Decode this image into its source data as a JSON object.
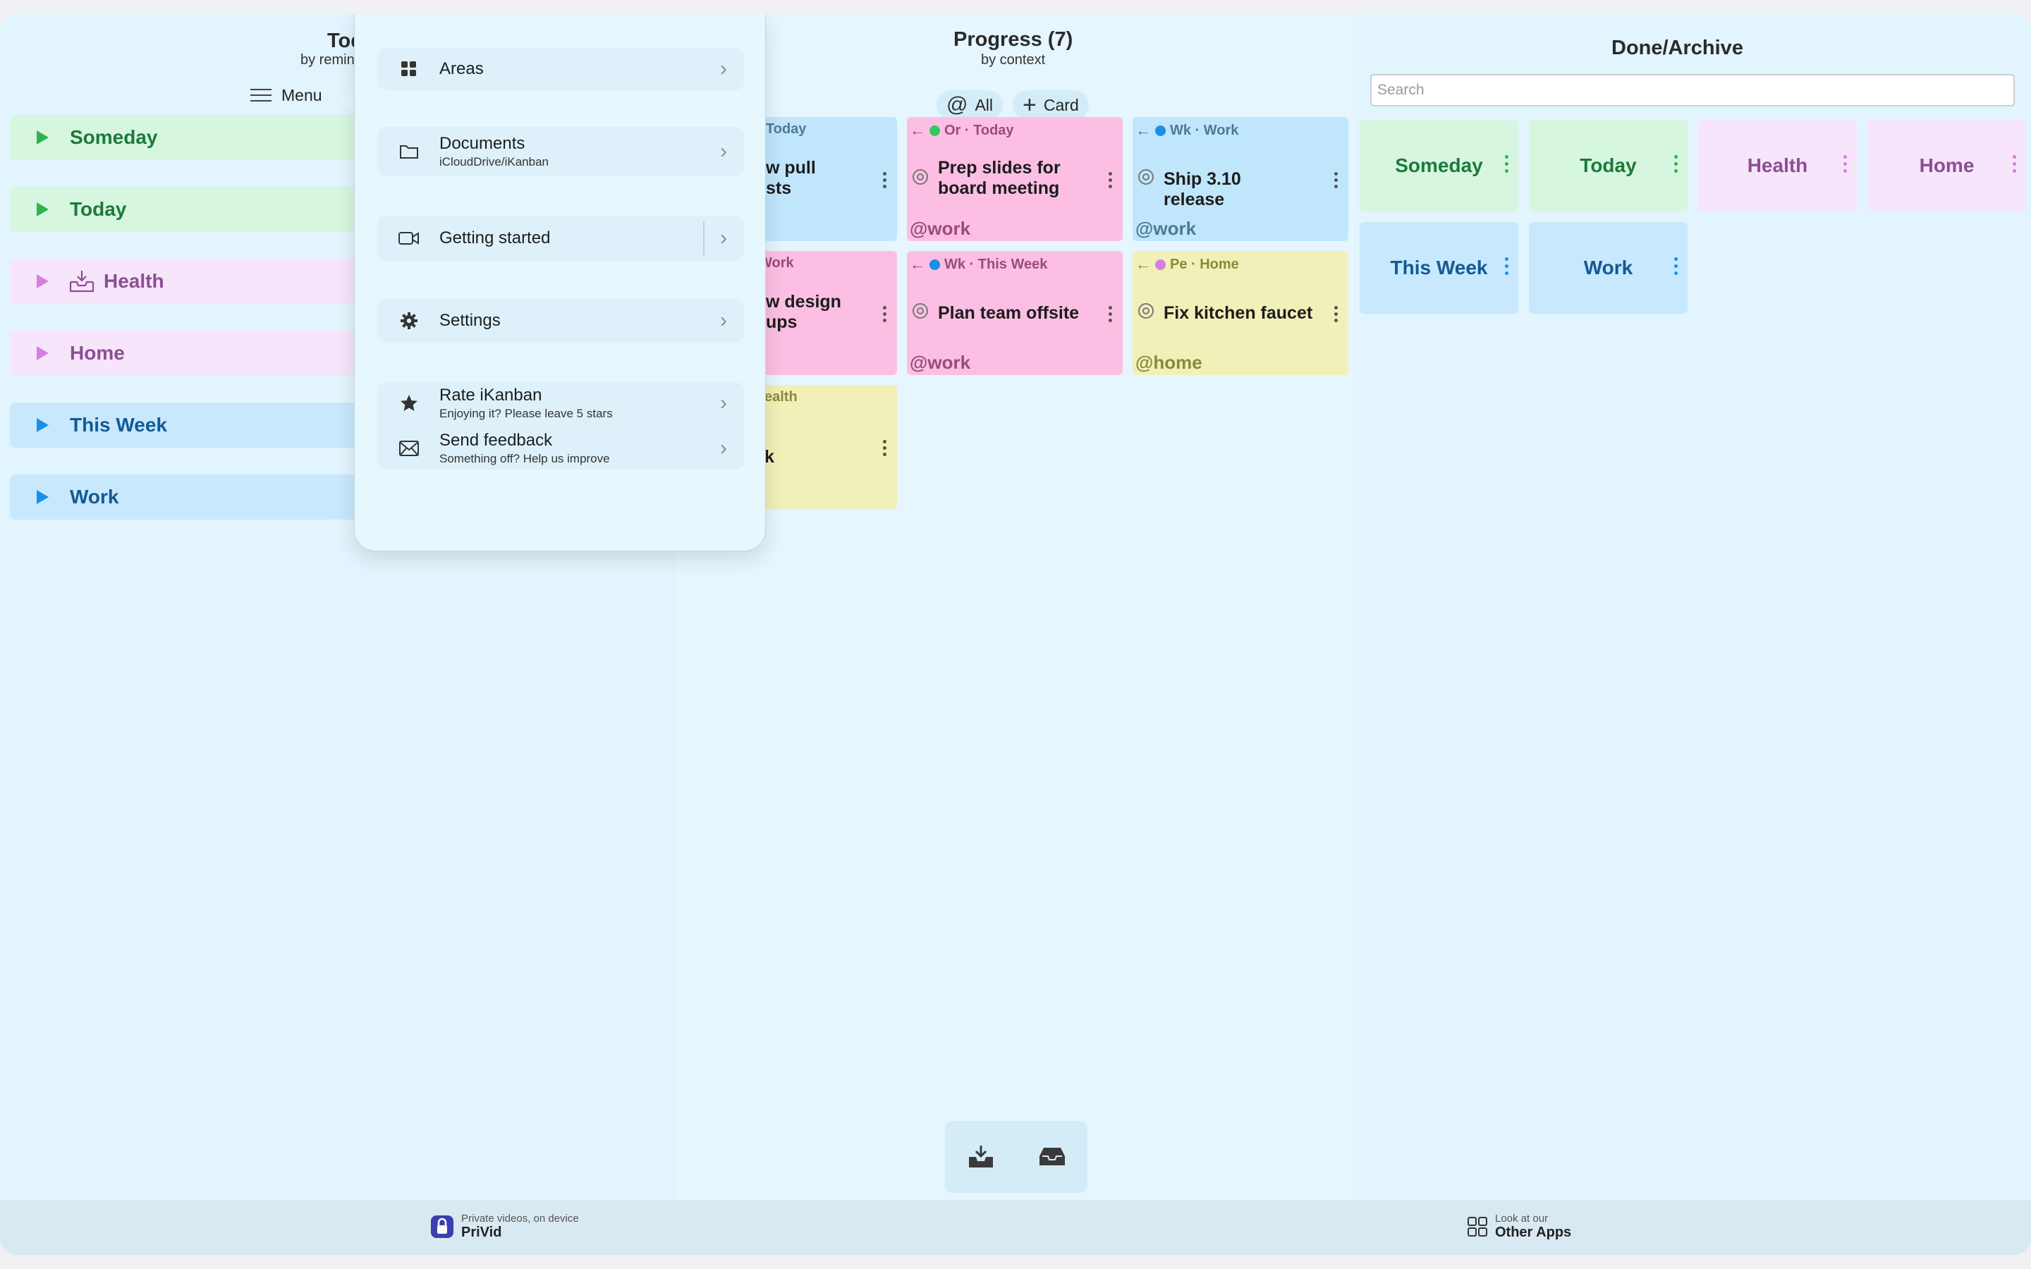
{
  "window": {
    "controls": [
      "close",
      "minimize",
      "zoom"
    ]
  },
  "todo": {
    "title": "Todo",
    "subtitle": "by reminders",
    "menu_label": "Menu",
    "areas": [
      {
        "label": "Someday",
        "color": "green"
      },
      {
        "label": "Today",
        "color": "green"
      },
      {
        "label": "Health",
        "color": "pink",
        "icon": "inbox-tray-icon"
      },
      {
        "label": "Home",
        "color": "pink"
      },
      {
        "label": "This Week",
        "color": "blue"
      },
      {
        "label": "Work",
        "color": "blue"
      }
    ]
  },
  "progress": {
    "title": "Progress (7)",
    "subtitle": "by context",
    "filter_label": "All",
    "add_card_label": "Card",
    "cards": [
      {
        "head": "Today",
        "title": "Review pull requests",
        "visible_title": "w pull\nsts",
        "tag": "",
        "color": "blue"
      },
      {
        "head": "Or · Today",
        "title": "Prep slides for board meeting",
        "tag": "@work",
        "color": "pink",
        "dot": "#34c759"
      },
      {
        "head": "Wk · Work",
        "title": "Ship 3.10 release",
        "tag": "@work",
        "color": "blue",
        "dot": "#1a8fe8"
      },
      {
        "head": "Work",
        "title": "Review design mockups",
        "visible_title": "w design\nups",
        "tag": "",
        "color": "pink"
      },
      {
        "head": "Wk · This Week",
        "title": "Plan team offsite",
        "tag": "@work",
        "color": "pink",
        "dot": "#1a8fe8"
      },
      {
        "head": "Pe · Home",
        "title": "Fix kitchen faucet",
        "tag": "@home",
        "color": "yellow",
        "dot": "#d77ee0"
      },
      {
        "head": "ealth",
        "title": "k",
        "tag": "",
        "color": "yellow"
      }
    ]
  },
  "done": {
    "title": "Done/Archive",
    "search_placeholder": "Search",
    "tiles": [
      {
        "label": "Someday",
        "color": "green"
      },
      {
        "label": "Today",
        "color": "green"
      },
      {
        "label": "Health",
        "color": "pink"
      },
      {
        "label": "Home",
        "color": "pink"
      },
      {
        "label": "This Week",
        "color": "blue"
      },
      {
        "label": "Work",
        "color": "blue"
      }
    ]
  },
  "menu_popover": {
    "items": [
      {
        "label": "Areas",
        "sub": "",
        "icon": "grid-icon"
      },
      {
        "label": "Documents",
        "sub": "iCloudDrive/iKanban",
        "icon": "folder-icon"
      },
      {
        "label": "Getting started",
        "sub": "",
        "icon": "video-camera-icon"
      },
      {
        "label": "Settings",
        "sub": "",
        "icon": "gear-icon"
      },
      {
        "label": "Rate iKanban",
        "sub": "Enjoying it? Please leave 5 stars",
        "icon": "star-icon"
      },
      {
        "label": "Send feedback",
        "sub": "Something off? Help us improve",
        "icon": "envelope-icon"
      }
    ]
  },
  "footer": {
    "left_promo": {
      "small": "Private videos, on device",
      "big": "PriVid"
    },
    "right_promo": {
      "small": "Look at our",
      "big": "Other Apps"
    }
  },
  "colors": {
    "window_bg": "#e3f5fd",
    "green_area": "#d6f6df",
    "pink_area": "#f7e5fb",
    "blue_area": "#c7e8fd",
    "card_pink": "#fcbfe3",
    "card_blue": "#c0e6fc",
    "card_yellow": "#f1f0b8"
  }
}
